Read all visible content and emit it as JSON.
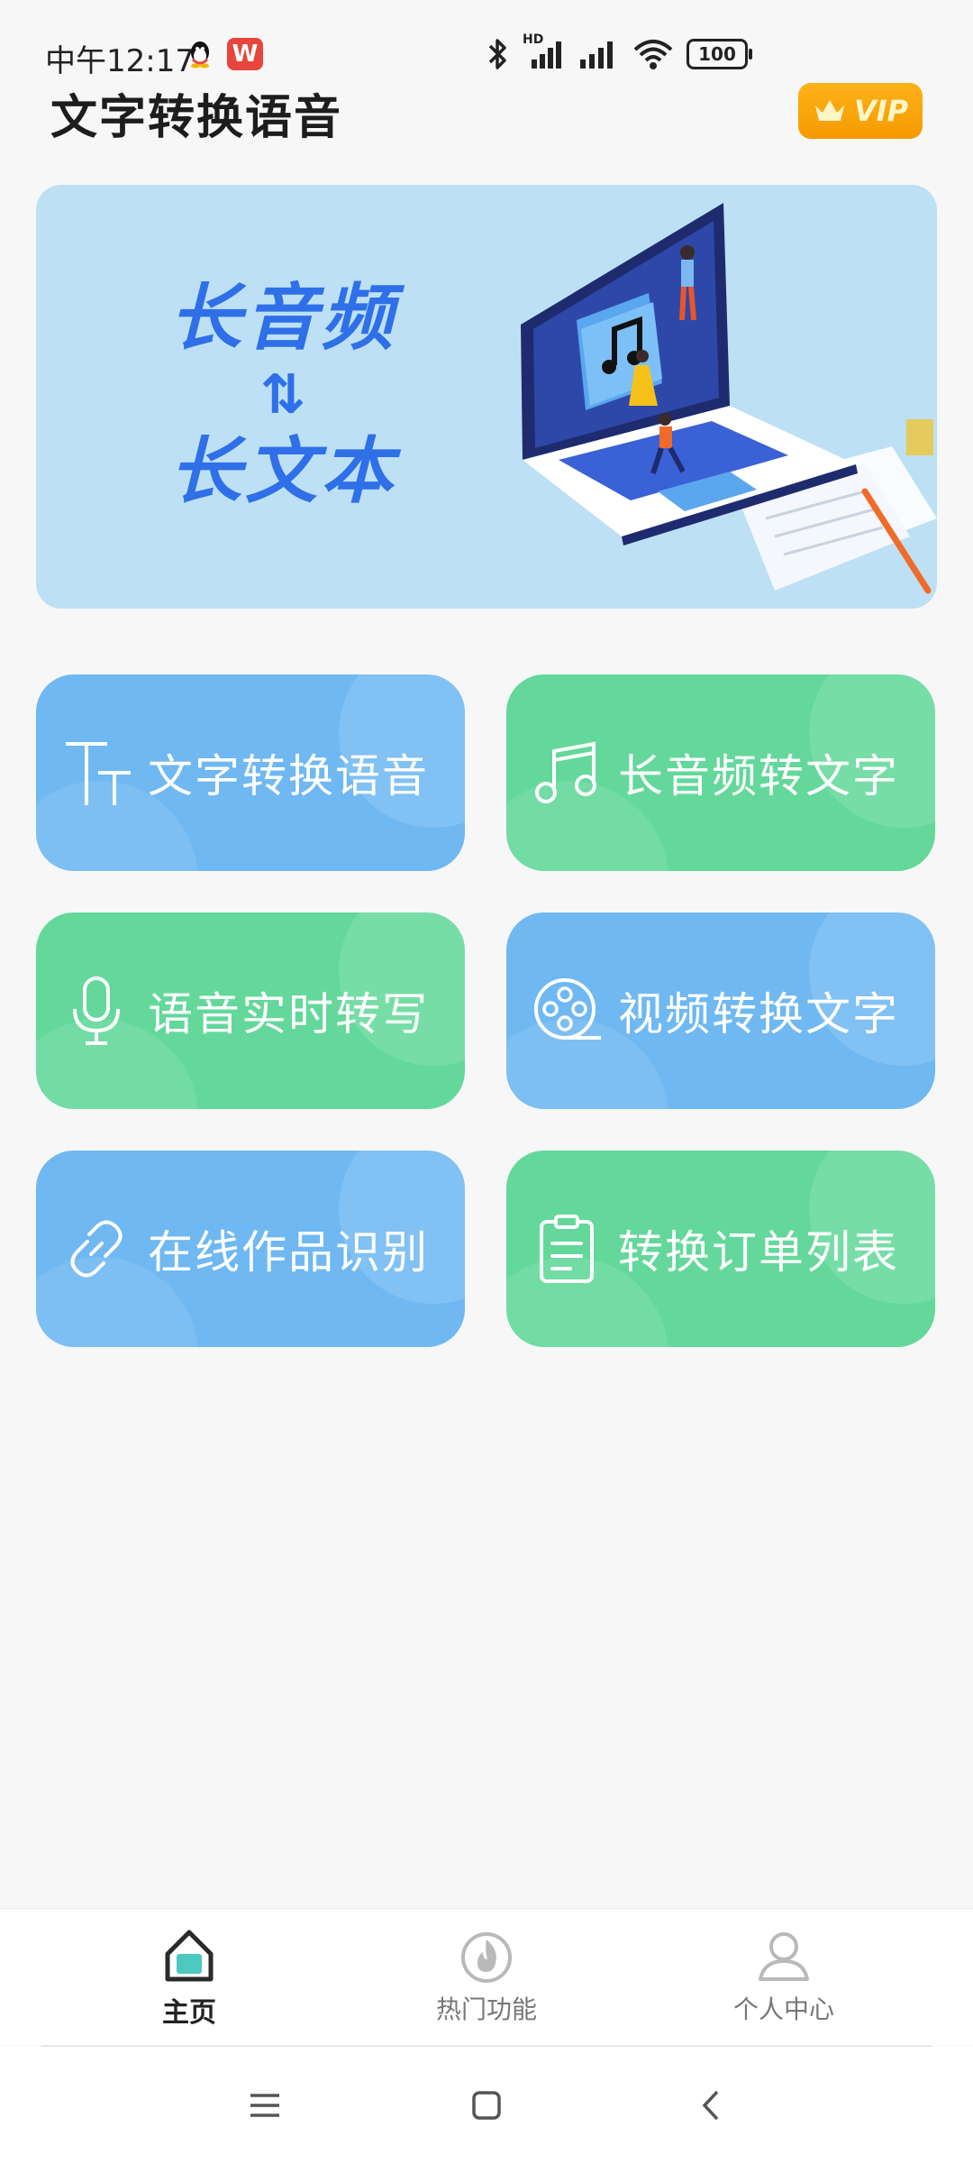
{
  "status_bar": {
    "time": "中午12:17",
    "weibo_glyph": "W",
    "hd_label": "HD",
    "battery": "100"
  },
  "header": {
    "title": "文字转换语音",
    "vip_label": "VIP"
  },
  "banner": {
    "line1": "长音频",
    "arrows": "⇅",
    "line2": "长文本"
  },
  "features": [
    {
      "label": "文字转换语音",
      "icon": "text-size-icon",
      "color": "#6fb8f2"
    },
    {
      "label": "长音频转文字",
      "icon": "music-note-icon",
      "color": "#63d89a"
    },
    {
      "label": "语音实时转写",
      "icon": "microphone-icon",
      "color": "#63d89a"
    },
    {
      "label": "视频转换文字",
      "icon": "film-reel-icon",
      "color": "#6fb8f2"
    },
    {
      "label": "在线作品识别",
      "icon": "link-icon",
      "color": "#6fb8f2"
    },
    {
      "label": "转换订单列表",
      "icon": "clipboard-icon",
      "color": "#63d89a"
    }
  ],
  "bottom_nav": {
    "items": [
      {
        "label": "主页",
        "icon": "home-icon",
        "active": true
      },
      {
        "label": "热门功能",
        "icon": "flame-icon",
        "active": false
      },
      {
        "label": "个人中心",
        "icon": "user-icon",
        "active": false
      }
    ]
  },
  "colors": {
    "accent_blue": "#6fb8f2",
    "accent_green": "#63d89a",
    "vip_orange": "#f5a000",
    "home_teal": "#4ec9c0"
  }
}
